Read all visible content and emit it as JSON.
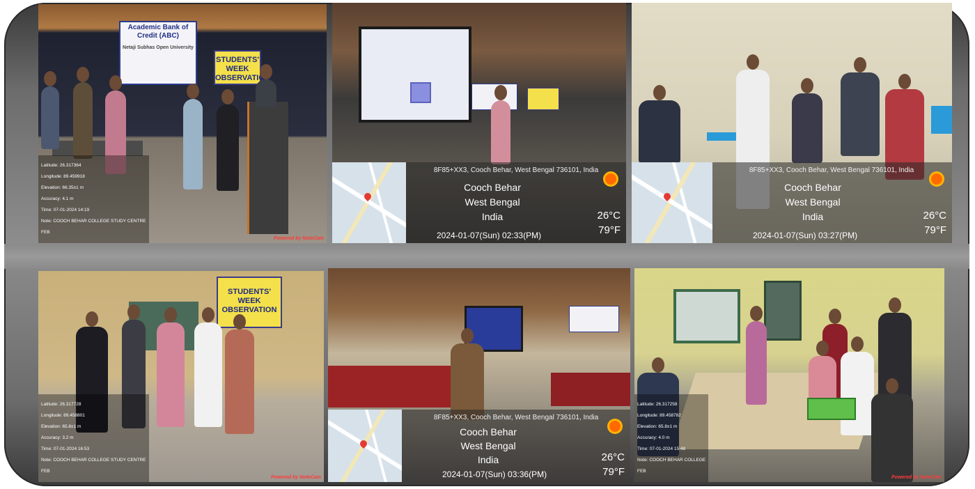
{
  "collage": {
    "photo1": {
      "banner_lines": [
        "Academic Bank of Credit (ABC)",
        "Netaji Subhas Open University"
      ],
      "sign_title": "STUDENTS' WEEK OBSERVATION",
      "info_lines": [
        "Latitude: 26.317364",
        "Longitude: 89.459918",
        "Elevation: 66.35±1 m",
        "Accuracy: 4.1 m",
        "Time: 07-01-2024 14:19",
        "Note: COOCH BEHAR COLLEGE STUDY CENTRE",
        "FEB"
      ],
      "powered": "Powered by NoteCam"
    },
    "photo2": {
      "address": "8F85+XX3, Cooch Behar, West Bengal 736101, India",
      "city": "Cooch Behar",
      "state": "West Bengal",
      "country": "India",
      "temp_c": "26°C",
      "temp_f": "79°F",
      "datetime": "2024-01-07(Sun)   02:33(PM)"
    },
    "photo3": {
      "address": "8F85+XX3, Cooch Behar, West Bengal 736101, India",
      "city": "Cooch Behar",
      "state": "West Bengal",
      "country": "India",
      "temp_c": "26°C",
      "temp_f": "79°F",
      "datetime": "2024-01-07(Sun)   03:27(PM)"
    },
    "photo4": {
      "sign_title": "STUDENTS' WEEK OBSERVATION",
      "info_lines": [
        "Latitude: 26.317728",
        "Longitude: 89.458801",
        "Elevation: 65.8±1 m",
        "Accuracy: 3.2 m",
        "Time: 07-01-2024 16:53",
        "Note: COOCH BEHAR COLLEGE STUDY CENTRE",
        "FEB"
      ],
      "powered": "Powered by NoteCam"
    },
    "photo5": {
      "address": "8F85+XX3, Cooch Behar, West Bengal 736101, India",
      "city": "Cooch Behar",
      "state": "West Bengal",
      "country": "India",
      "temp_c": "26°C",
      "temp_f": "79°F",
      "datetime": "2024-01-07(Sun)   03:36(PM)"
    },
    "photo6": {
      "info_lines": [
        "Latitude: 26.317258",
        "Longitude: 89.458782",
        "Elevation: 65.8±1 m",
        "Accuracy: 4.0 m",
        "Time: 07-01-2024 15:48",
        "Note: COOCH BEHAR COLLEGE",
        "FEB"
      ],
      "powered": "Powered by NoteCam"
    }
  }
}
